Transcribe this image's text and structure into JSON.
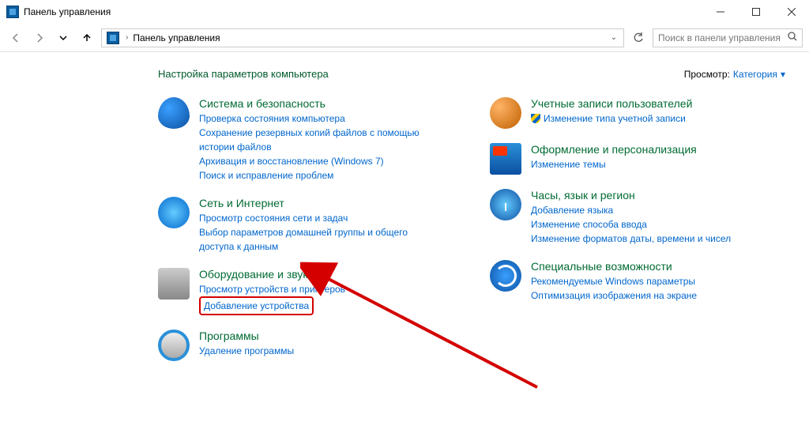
{
  "window": {
    "title": "Панель управления"
  },
  "toolbar": {
    "breadcrumb": "Панель управления",
    "search_placeholder": "Поиск в панели управления"
  },
  "header": {
    "page_title": "Настройка параметров компьютера",
    "view_label": "Просмотр:",
    "view_value": "Категория"
  },
  "left_column": [
    {
      "title": "Система и безопасность",
      "links": [
        "Проверка состояния компьютера",
        "Сохранение резервных копий файлов с помощью истории файлов",
        "Архивация и восстановление (Windows 7)",
        "Поиск и исправление проблем"
      ]
    },
    {
      "title": "Сеть и Интернет",
      "links": [
        "Просмотр состояния сети и задач",
        "Выбор параметров домашней группы и общего доступа к данным"
      ]
    },
    {
      "title": "Оборудование и звук",
      "links": [
        "Просмотр устройств и принтеров",
        "Добавление устройства"
      ]
    },
    {
      "title": "Программы",
      "links": [
        "Удаление программы"
      ]
    }
  ],
  "right_column": [
    {
      "title": "Учетные записи пользователей",
      "links": [
        "Изменение типа учетной записи"
      ],
      "shield": [
        true
      ]
    },
    {
      "title": "Оформление и персонализация",
      "links": [
        "Изменение темы"
      ]
    },
    {
      "title": "Часы, язык и регион",
      "links": [
        "Добавление языка",
        "Изменение способа ввода",
        "Изменение форматов даты, времени и чисел"
      ]
    },
    {
      "title": "Специальные возможности",
      "links": [
        "Рекомендуемые Windows параметры",
        "Оптимизация изображения на экране"
      ]
    }
  ]
}
